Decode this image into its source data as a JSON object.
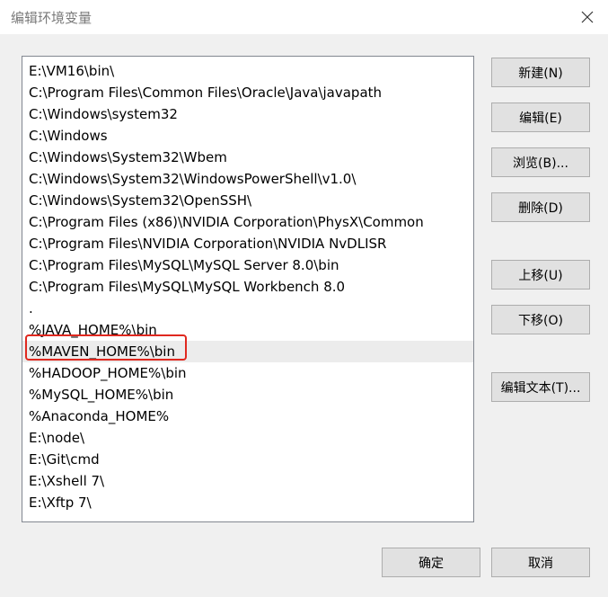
{
  "window": {
    "title": "编辑环境变量"
  },
  "list": {
    "items": [
      "E:\\VM16\\bin\\",
      "C:\\Program Files\\Common Files\\Oracle\\Java\\javapath",
      "C:\\Windows\\system32",
      "C:\\Windows",
      "C:\\Windows\\System32\\Wbem",
      "C:\\Windows\\System32\\WindowsPowerShell\\v1.0\\",
      "C:\\Windows\\System32\\OpenSSH\\",
      "C:\\Program Files (x86)\\NVIDIA Corporation\\PhysX\\Common",
      "C:\\Program Files\\NVIDIA Corporation\\NVIDIA NvDLISR",
      "C:\\Program Files\\MySQL\\MySQL Server 8.0\\bin",
      "C:\\Program Files\\MySQL\\MySQL Workbench 8.0",
      ".",
      "%JAVA_HOME%\\bin",
      "%MAVEN_HOME%\\bin",
      "%HADOOP_HOME%\\bin",
      "%MySQL_HOME%\\bin",
      "%Anaconda_HOME%",
      "E:\\node\\",
      "E:\\Git\\cmd",
      "E:\\Xshell 7\\",
      "E:\\Xftp 7\\"
    ],
    "selected_index": 13
  },
  "buttons": {
    "new": "新建(N)",
    "edit": "编辑(E)",
    "browse": "浏览(B)...",
    "delete": "删除(D)",
    "move_up": "上移(U)",
    "move_down": "下移(O)",
    "edit_text": "编辑文本(T)...",
    "ok": "确定",
    "cancel": "取消"
  },
  "colors": {
    "highlight_box": "#e0281f",
    "selected_row": "#ececec"
  }
}
